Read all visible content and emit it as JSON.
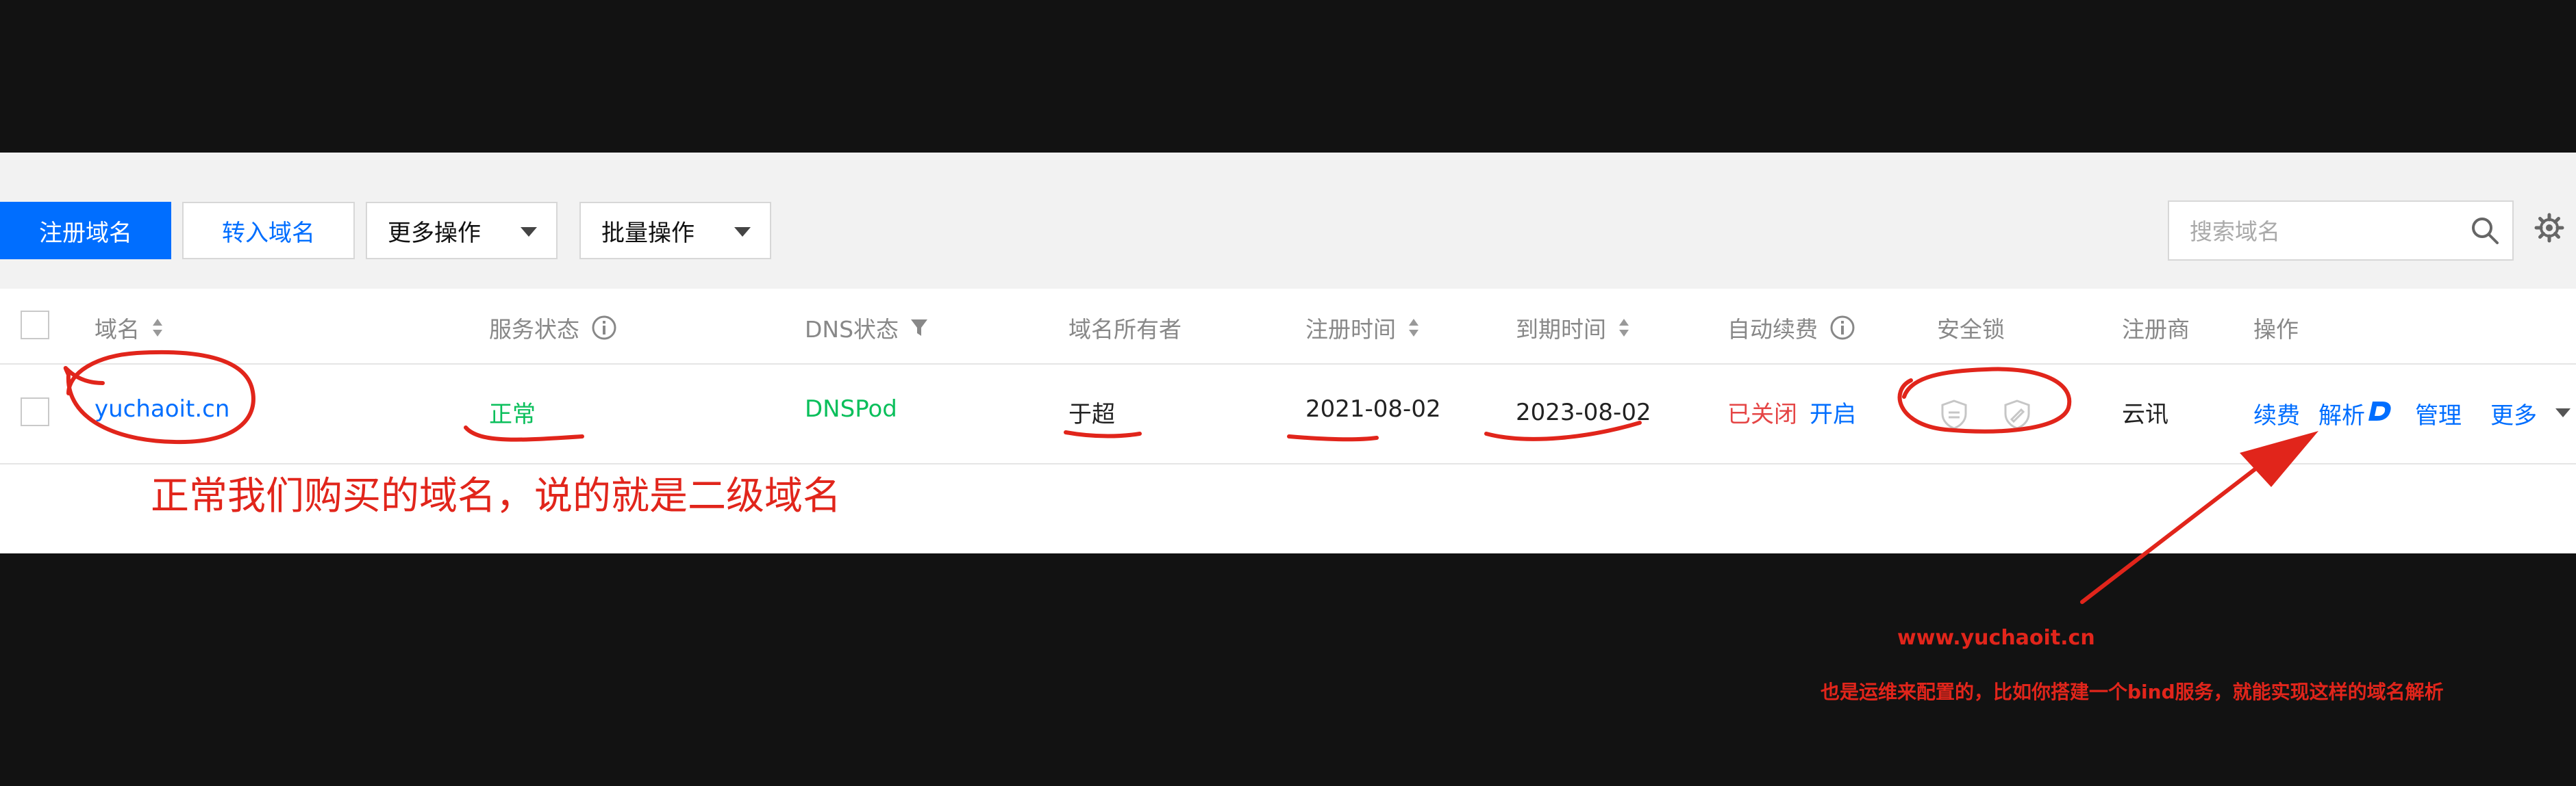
{
  "toolbar": {
    "register_label": "注册域名",
    "transfer_label": "转入域名",
    "more_ops_label": "更多操作",
    "batch_ops_label": "批量操作",
    "search_placeholder": "搜索域名"
  },
  "table": {
    "headers": {
      "domain": "域名",
      "service_status": "服务状态",
      "dns_status": "DNS状态",
      "owner": "域名所有者",
      "reg_time": "注册时间",
      "expire_time": "到期时间",
      "auto_renew": "自动续费",
      "security_lock": "安全锁",
      "registrar": "注册商",
      "actions": "操作"
    },
    "rows": [
      {
        "domain": "yuchaoit.cn",
        "service_status": "正常",
        "dns_status": "DNSPod",
        "owner": "于超",
        "reg_time": "2021-08-02",
        "expire_time": "2023-08-02",
        "auto_renew_state": "已关闭",
        "auto_renew_action": "开启",
        "registrar": "云讯",
        "actions": [
          "续费",
          "解析",
          "管理",
          "更多"
        ]
      }
    ]
  },
  "annotations": {
    "main_note": "正常我们购买的域名，说的就是二级域名",
    "url_note": "www.yuchaoit.cn",
    "desc_note": "也是运维来配置的，比如你搭建一个bind服务，就能实现这样的域名解析"
  },
  "colors": {
    "primary": "#006eff",
    "status_green": "#0abf5b",
    "status_red": "#e54545",
    "annotation_red": "#e1251b",
    "background": "#121212"
  },
  "icons": [
    "search-icon",
    "gear-icon",
    "sort-icon",
    "info-icon",
    "filter-icon",
    "lock-icon",
    "dnspod-icon",
    "chevron-down-icon"
  ]
}
